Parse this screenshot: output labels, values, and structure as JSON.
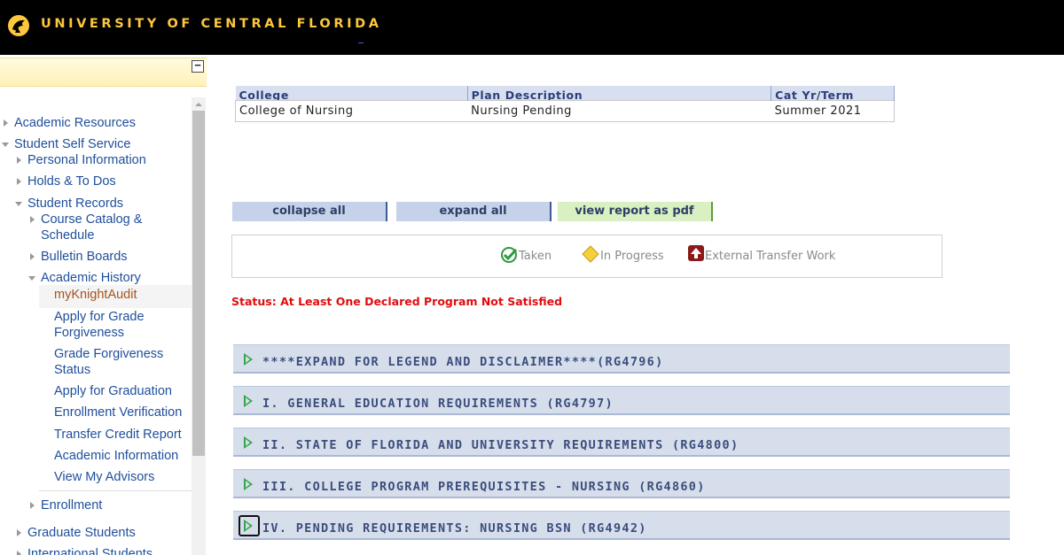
{
  "header": {
    "title": "UNIVERSITY OF CENTRAL FLORIDA",
    "logo_icon": "pegasus-logo-icon"
  },
  "nav": {
    "items": [
      {
        "label": "Academic Resources"
      },
      {
        "label": "Student Self Service"
      },
      {
        "label": "Personal Information"
      },
      {
        "label": "Holds & To Dos"
      },
      {
        "label": "Student Records"
      },
      {
        "label": "Course Catalog &"
      },
      {
        "label": "Schedule"
      },
      {
        "label": "Bulletin Boards"
      },
      {
        "label": "Academic History"
      },
      {
        "label": "myKnightAudit"
      },
      {
        "label": "Apply for Grade"
      },
      {
        "label": "Forgiveness"
      },
      {
        "label": "Grade Forgiveness"
      },
      {
        "label": "Status"
      },
      {
        "label": "Apply for Graduation"
      },
      {
        "label": "Enrollment Verification"
      },
      {
        "label": "Transfer Credit Report"
      },
      {
        "label": "Academic Information"
      },
      {
        "label": "View My Advisors"
      },
      {
        "label": "Enrollment"
      },
      {
        "label": "Graduate Students"
      },
      {
        "label": "International Students"
      }
    ],
    "collapse_symbol": "−"
  },
  "plan": {
    "headers": [
      "College",
      "Plan Description",
      "Cat Yr/Term"
    ],
    "row": [
      "College of Nursing",
      "Nursing Pending",
      "Summer 2021"
    ]
  },
  "toolbar": {
    "collapse_label": "collapse all",
    "expand_label": "expand all",
    "pdf_label": "view report as pdf"
  },
  "legend": {
    "taken": "Taken",
    "in_progress": "In Progress",
    "transfer": "External Transfer Work"
  },
  "status_text": "Status: At Least One Declared Program Not Satisfied",
  "requirements": [
    "****EXPAND FOR LEGEND AND DISCLAIMER****(RG4796)",
    "I. GENERAL EDUCATION REQUIREMENTS (RG4797)",
    "II. STATE OF FLORIDA AND UNIVERSITY REQUIREMENTS (RG4800)",
    "III. COLLEGE PROGRAM PREREQUISITES - NURSING (RG4860)",
    "IV. PENDING REQUIREMENTS: NURSING BSN (RG4942)"
  ],
  "colors": {
    "brand_gold": "#fdc73e",
    "status_red": "#e00d0d",
    "link_blue": "#1f4f9b",
    "active_link": "#a8531f"
  }
}
